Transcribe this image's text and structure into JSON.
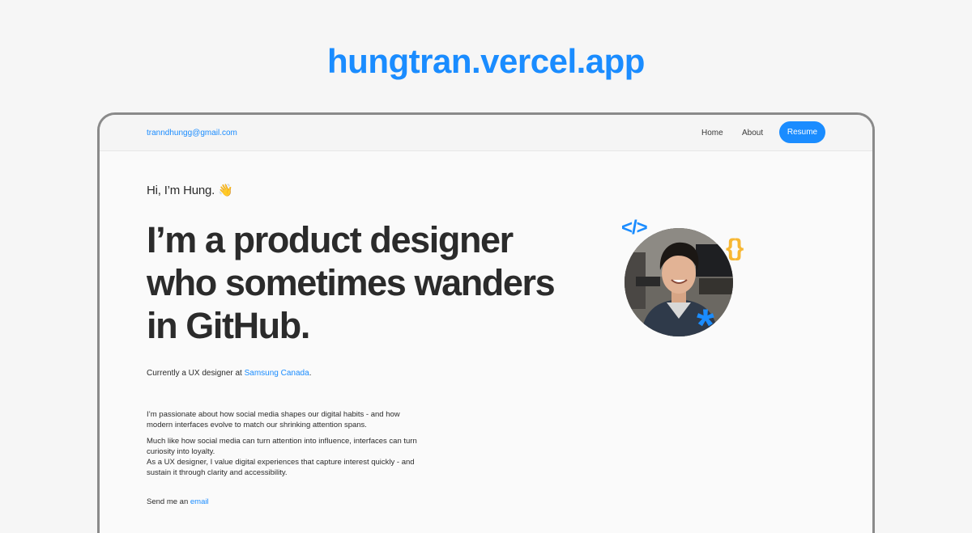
{
  "banner": {
    "url": "hungtran.vercel.app"
  },
  "nav": {
    "email": "tranndhungg@gmail.com",
    "home": "Home",
    "about": "About",
    "resume": "Resume"
  },
  "hero": {
    "greeting": "Hi, I’m Hung. 👋",
    "headline": "I’m a product designer who sometimes wanders in GitHub.",
    "current_prefix": "Currently a UX designer at ",
    "current_link": "Samsung Canada",
    "current_suffix": ".",
    "bio_paragraph_1": "I’m passionate about how social media shapes our digital habits - and how modern interfaces evolve to match our shrinking attention spans.",
    "bio_paragraph_2_line_1": "Much like how social media can turn attention into influence, interfaces can turn curiosity into loyalty.",
    "bio_paragraph_2_line_2": "As a UX designer, I value digital experiences that capture interest quickly - and sustain it through clarity and accessibility.",
    "contact_prefix": "Send me an ",
    "contact_link": "email"
  },
  "decorations": {
    "code_tag": "</>",
    "braces": "{}",
    "asterisk": "*"
  },
  "icons": {
    "code": "code-tag-icon",
    "braces": "curly-braces-icon",
    "asterisk": "asterisk-icon",
    "wave": "waving-hand-icon"
  },
  "colors": {
    "accent": "#1a8cff",
    "braces": "#f7b733",
    "text": "#2b2b2b",
    "page_background": "#f6f6f6"
  }
}
